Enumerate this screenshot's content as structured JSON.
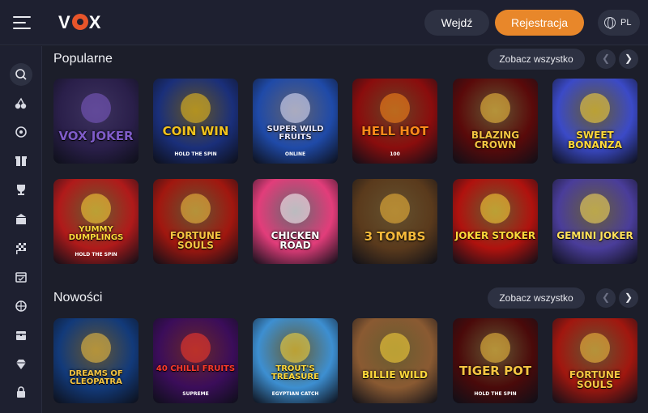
{
  "header": {
    "logo": "VOX",
    "login_label": "Wejdź",
    "register_label": "Rejestracja",
    "language": "PL"
  },
  "sidebar": {
    "icons": [
      "search-icon",
      "cherries-icon",
      "roulette-icon",
      "gift-icon",
      "trophy-icon",
      "store-icon",
      "race-flag-icon",
      "calendar-icon",
      "sport-ball-icon",
      "treasure-chest-icon",
      "diamond-icon",
      "lock-icon"
    ]
  },
  "sections": [
    {
      "title": "Popularne",
      "see_all_label": "Zobacz wszystko",
      "games": [
        {
          "title": "VOX JOKER",
          "subtitle": "",
          "bg": "#2a1f4a",
          "accent": "#7f5cc9"
        },
        {
          "title": "COIN WIN",
          "subtitle": "HOLD THE SPIN",
          "bg": "#1a2f7a",
          "accent": "#f2c21d"
        },
        {
          "title": "SUPER WILD FRUITS",
          "subtitle": "Online",
          "bg": "#1f4aa8",
          "accent": "#e8e8ff"
        },
        {
          "title": "HELL HOT",
          "subtitle": "100",
          "bg": "#8a0d0d",
          "accent": "#ff8a1a"
        },
        {
          "title": "BLAZING CROWN",
          "subtitle": "",
          "bg": "#5a0a0a",
          "accent": "#f5c542"
        },
        {
          "title": "SWEET BONANZA",
          "subtitle": "",
          "bg": "#3b4ac7",
          "accent": "#ffd93b"
        },
        {
          "title": "YUMMY DUMPLINGS",
          "subtitle": "HOLD THE SPIN",
          "bg": "#b01a1a",
          "accent": "#ffd93b"
        },
        {
          "title": "FORTUNE SOULS",
          "subtitle": "",
          "bg": "#a1170f",
          "accent": "#f5c542"
        },
        {
          "title": "CHICKEN ROAD",
          "subtitle": "",
          "bg": "#e23d7a",
          "accent": "#ffffff"
        },
        {
          "title": "3 TOMBS",
          "subtitle": "",
          "bg": "#5a3a1c",
          "accent": "#f5b93a"
        },
        {
          "title": "JOKER STOKER",
          "subtitle": "",
          "bg": "#b0120e",
          "accent": "#ffd93b"
        },
        {
          "title": "GEMINI JOKER",
          "subtitle": "",
          "bg": "#4a3d9a",
          "accent": "#ffe15a"
        }
      ]
    },
    {
      "title": "Nowości",
      "see_all_label": "Zobacz wszystko",
      "games": [
        {
          "title": "DREAMS OF CLEOPATRA",
          "subtitle": "",
          "bg": "#123a7a",
          "accent": "#f5c542"
        },
        {
          "title": "40 CHILLI FRUITS",
          "subtitle": "Supreme",
          "bg": "#3b0d5a",
          "accent": "#ff3a2a"
        },
        {
          "title": "TROUT'S TREASURE",
          "subtitle": "EGYPTIAN CATCH",
          "bg": "#3d8fd1",
          "accent": "#ffd93b"
        },
        {
          "title": "BILLIE WILD",
          "subtitle": "",
          "bg": "#8a5a32",
          "accent": "#ffd93b"
        },
        {
          "title": "TIGER POT",
          "subtitle": "HOLD THE SPIN",
          "bg": "#4a0a0a",
          "accent": "#f5c542"
        },
        {
          "title": "FORTUNE SOULS",
          "subtitle": "",
          "bg": "#a1170f",
          "accent": "#f5c542"
        }
      ]
    }
  ]
}
